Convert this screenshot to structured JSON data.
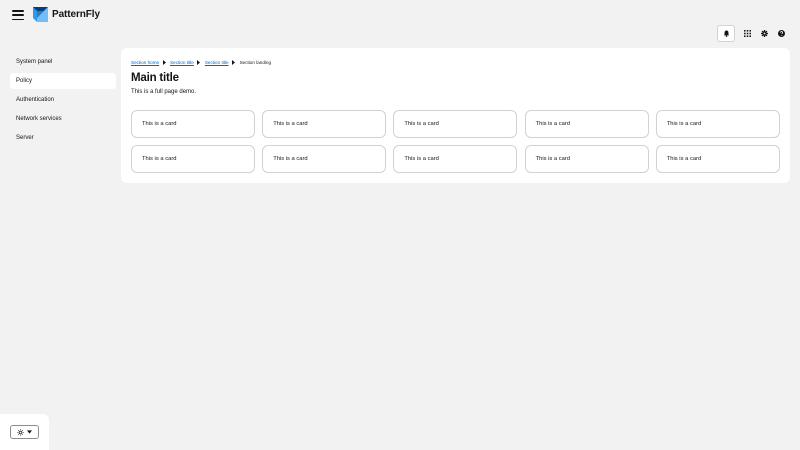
{
  "header": {
    "brand_name": "PatternFly",
    "icons": {
      "menu": "hamburger-menu-icon",
      "logo": "patternfly-logo-icon",
      "notifications": "bell-icon",
      "apps": "grid-icon",
      "settings": "gear-icon",
      "help": "question-circle-icon"
    }
  },
  "sidebar": {
    "items": [
      {
        "label": "System panel",
        "active": false
      },
      {
        "label": "Policy",
        "active": true
      },
      {
        "label": "Authentication",
        "active": false
      },
      {
        "label": "Network services",
        "active": false
      },
      {
        "label": "Server",
        "active": false
      }
    ],
    "footer": {
      "theme_icon": "sun-icon",
      "dropdown_icon": "caret-down-icon"
    }
  },
  "main": {
    "breadcrumb": [
      {
        "label": "Section home",
        "link": true
      },
      {
        "label": "Section title",
        "link": true
      },
      {
        "label": "Section title",
        "link": true
      },
      {
        "label": "Section landing",
        "link": false
      }
    ],
    "title": "Main title",
    "description": "This is a full page demo.",
    "cards": [
      "This is a card",
      "This is a card",
      "This is a card",
      "This is a card",
      "This is a card",
      "This is a card",
      "This is a card",
      "This is a card",
      "This is a card",
      "This is a card"
    ]
  },
  "colors": {
    "background": "#f2f2f2",
    "panel": "#ffffff",
    "link": "#0066cc",
    "text": "#151515",
    "border": "#d2d2d2",
    "logo_dark": "#004080",
    "logo_light": "#2b9af3"
  }
}
